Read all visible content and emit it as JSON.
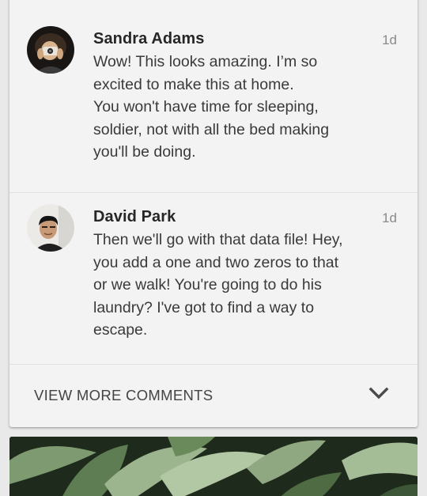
{
  "comments": [
    {
      "author": "Sandra Adams",
      "time": "1d",
      "text": "Wow! This looks amazing. I’m so\nexcited to make this at home.\nYou won't have time for sleeping,\nsoldier, not with all the bed making\nyou'll be doing."
    },
    {
      "author": "David Park",
      "time": "1d",
      "text": "Then we'll go with that data file! Hey,\nyou add a one and two zeros to that\nor we walk! You're going to do his\nlaundry? I've got to find a way to\nescape."
    }
  ],
  "view_more": {
    "label": "VIEW MORE COMMENTS",
    "icon": "chevron-down-icon"
  },
  "colors": {
    "card_bg": "#f3f3f3",
    "page_bg": "#e9e9e9",
    "text_primary": "#262626",
    "text_secondary": "#8a8a8a"
  }
}
